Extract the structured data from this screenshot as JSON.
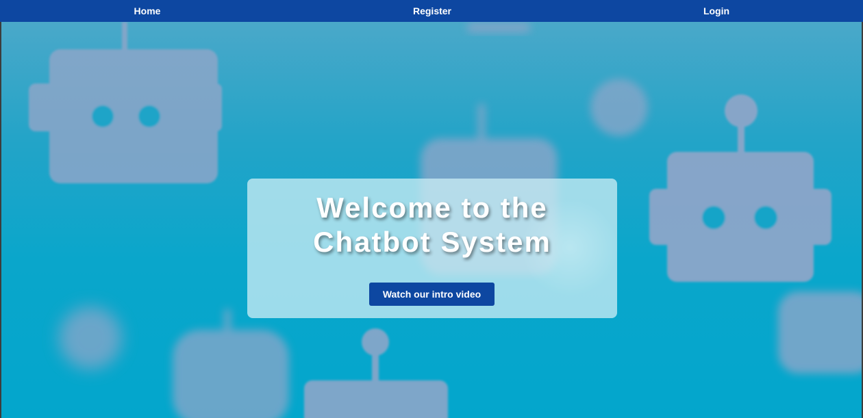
{
  "nav": {
    "home_label": "Home",
    "register_label": "Register",
    "login_label": "Login"
  },
  "hero": {
    "title_line1": "Welcome to the",
    "title_line2": "Chatbot System",
    "cta_label": "Watch our intro video"
  },
  "colors": {
    "nav_background": "#0d47a1",
    "button_background": "#0d47a1",
    "hero_background": "#03a6cc",
    "robot_tint": "#8ca6c9"
  },
  "background_icons": [
    "robot-icon"
  ]
}
